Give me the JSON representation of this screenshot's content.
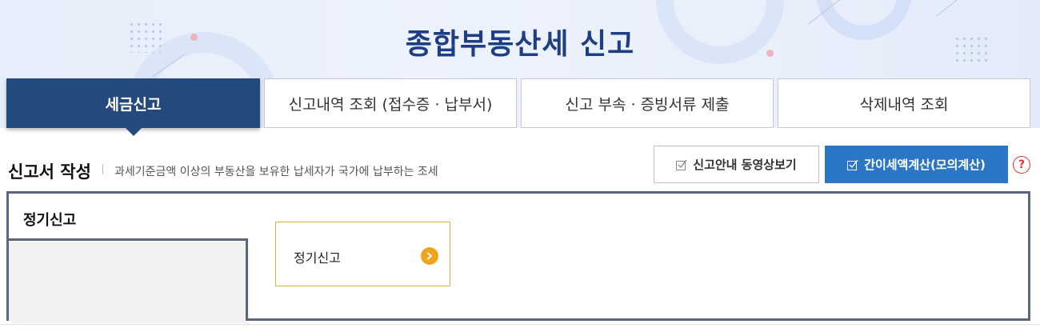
{
  "header": {
    "title": "종합부동산세  신고"
  },
  "tabs": [
    {
      "label": "세금신고",
      "active": true
    },
    {
      "label": "신고내역 조회 (접수증 · 납부서)",
      "active": false
    },
    {
      "label": "신고 부속 · 증빙서류 제출",
      "active": false
    },
    {
      "label": "삭제내역 조회",
      "active": false
    }
  ],
  "section": {
    "title": "신고서 작성",
    "description": "과세기준금액 이상의 부동산을 보유한 납세자가 국가에 납부하는 조세"
  },
  "actions": {
    "video_label": "신고안내 동영상보기",
    "calc_label": "간이세액계산(모의계산)",
    "help_glyph": "?"
  },
  "panel": {
    "label": "정기신고",
    "card_label": "정기신고"
  },
  "colors": {
    "title": "#1d3d84",
    "active_tab": "#24497c",
    "calc_button": "#2c76c8",
    "card_border": "#d9b24e",
    "card_arrow": "#f1a51f",
    "help": "#e0323b",
    "panel_border": "#586680"
  },
  "icons": [
    "check-icon",
    "question-icon",
    "chevron-right-icon"
  ]
}
